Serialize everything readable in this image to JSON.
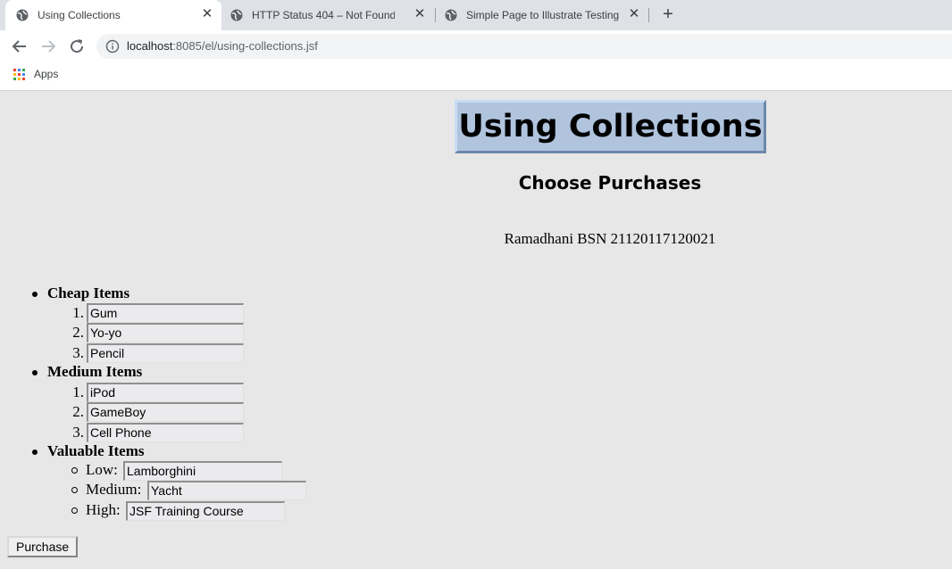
{
  "browser": {
    "tabs": [
      {
        "title": "Using Collections",
        "active": true
      },
      {
        "title": "HTTP Status 404 – Not Found",
        "active": false
      },
      {
        "title": "Simple Page to Illustrate Testing",
        "active": false
      }
    ],
    "address": {
      "host": "localhost",
      "path": ":8085/el/using-collections.jsf"
    },
    "bookmarks": {
      "apps_label": "Apps"
    }
  },
  "page": {
    "title": "Using Collections",
    "subtitle": "Choose Purchases",
    "author": "Ramadhani BSN 21120117120021",
    "categories": [
      {
        "label": "Cheap Items",
        "items": [
          "Gum",
          "Yo-yo",
          "Pencil"
        ]
      },
      {
        "label": "Medium Items",
        "items": [
          "iPod",
          "GameBoy",
          "Cell Phone"
        ]
      },
      {
        "label": "Valuable Items",
        "items": [
          {
            "label": "Low:",
            "value": "Lamborghini"
          },
          {
            "label": "Medium:",
            "value": "Yacht"
          },
          {
            "label": "High:",
            "value": "JSF Training Course"
          }
        ]
      }
    ],
    "purchase_label": "Purchase"
  },
  "colors": {
    "page_bg": "#e7e7e7",
    "title_bg": "#b0c4de",
    "field_bg": "#ebebee",
    "tabstrip_bg": "#dee1e6"
  }
}
